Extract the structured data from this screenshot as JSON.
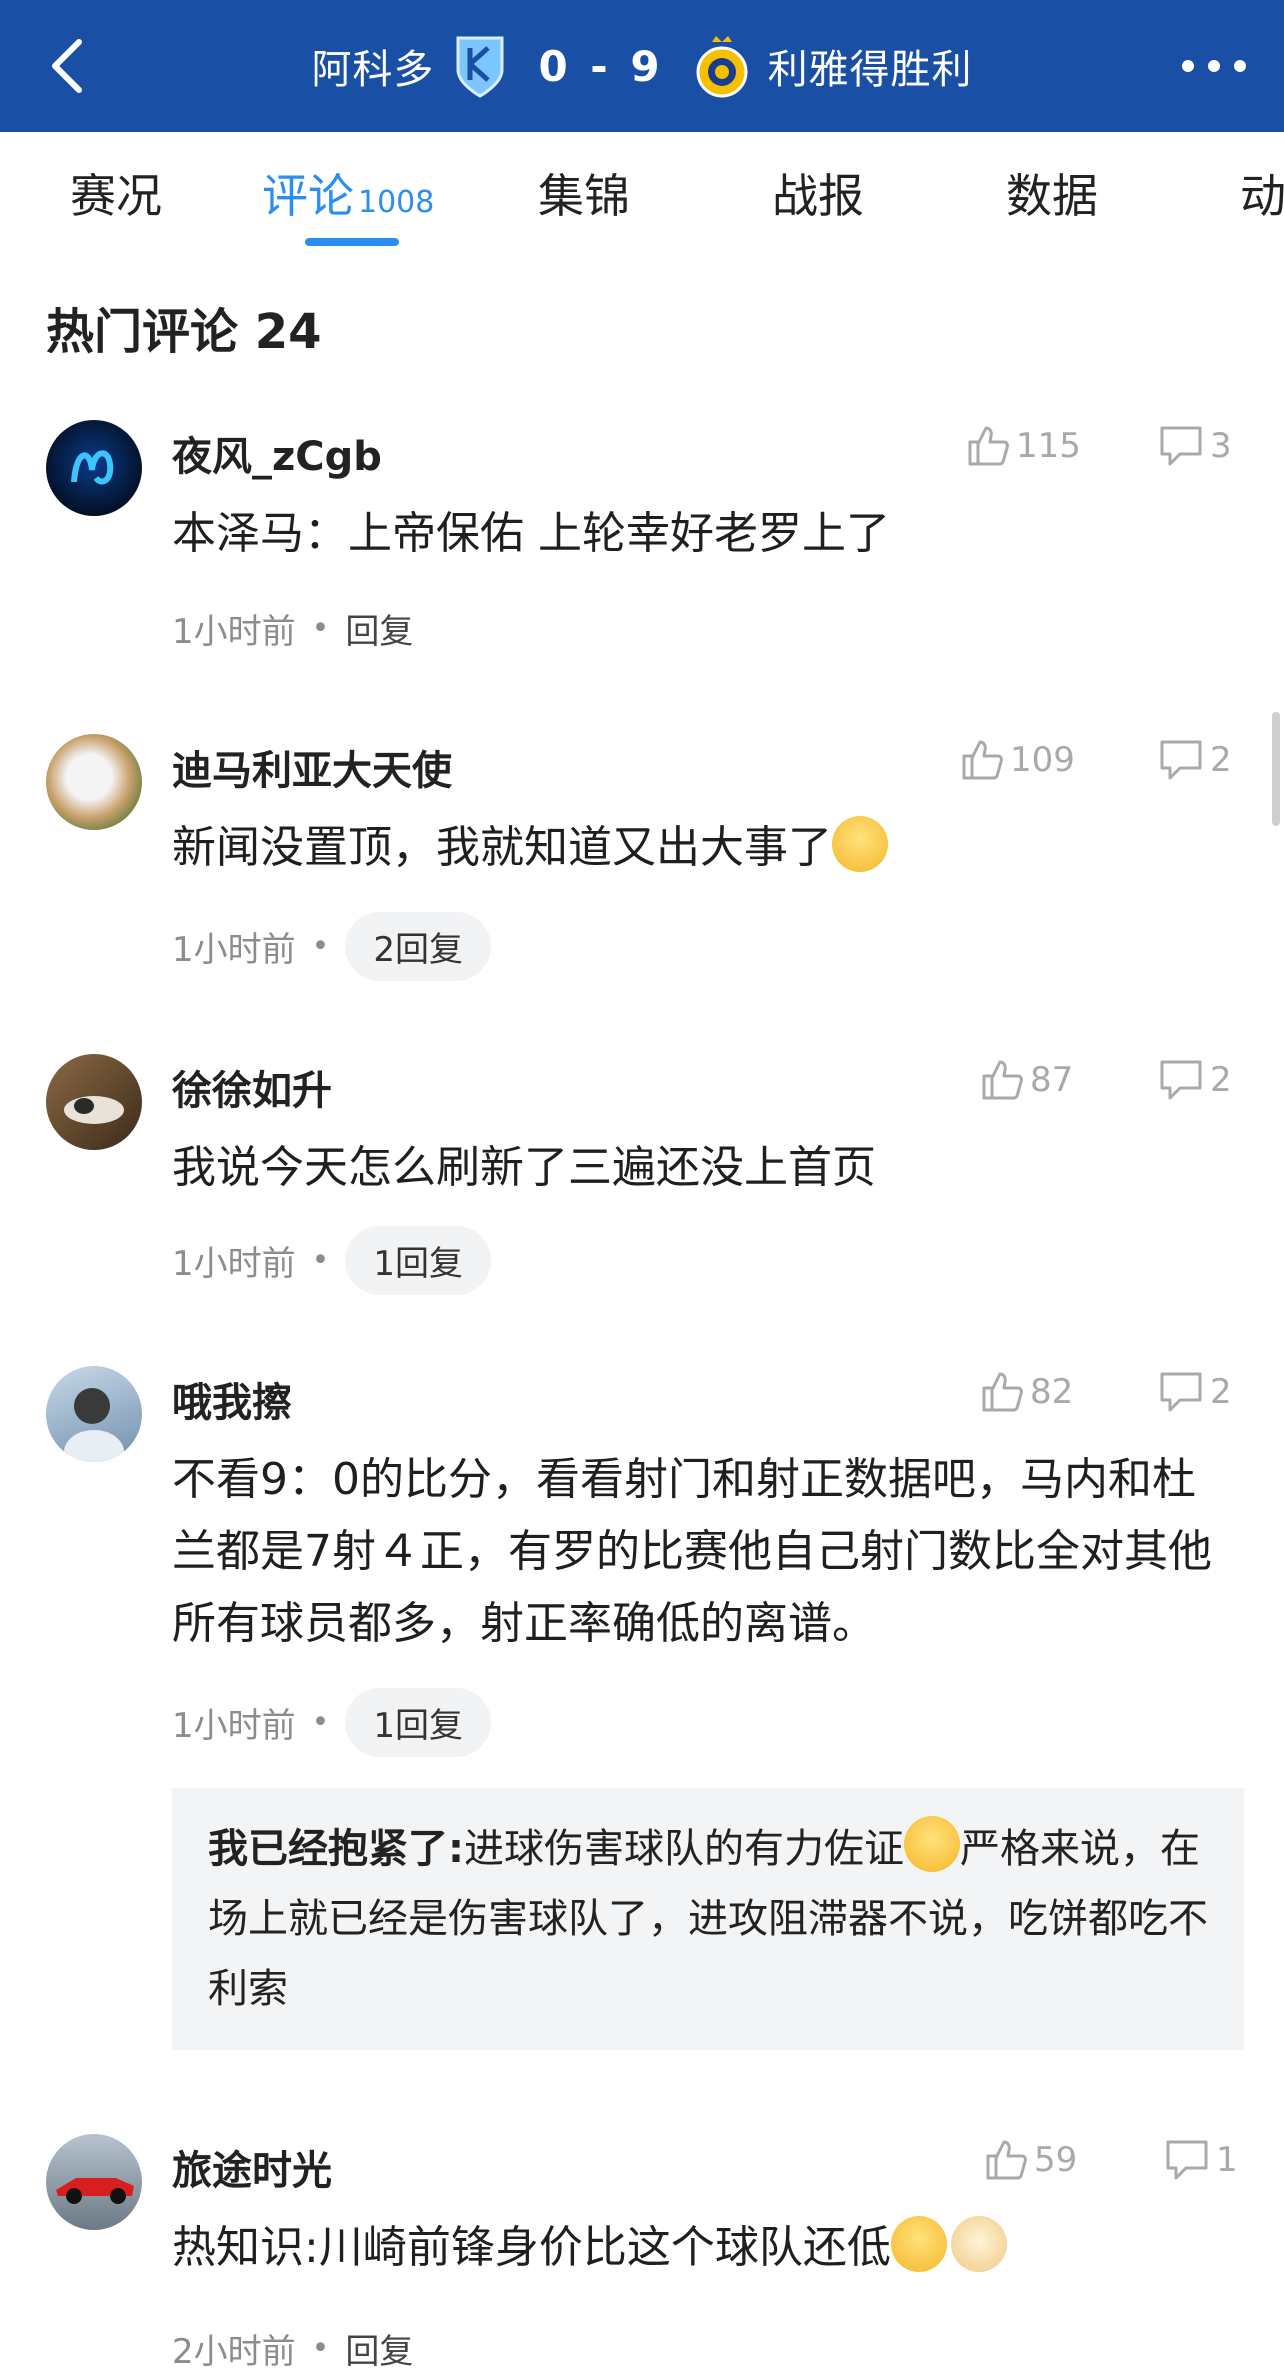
{
  "header": {
    "home_team": "阿科多",
    "score": "0 - 9",
    "away_result": "利雅得胜利",
    "colors": {
      "bar": "#1a4fa6",
      "accent": "#2b8ef0"
    }
  },
  "tabs": [
    {
      "label": "赛况"
    },
    {
      "label": "评论",
      "count": "1008",
      "active": true
    },
    {
      "label": "集锦"
    },
    {
      "label": "战报"
    },
    {
      "label": "数据"
    },
    {
      "label": "动"
    }
  ],
  "hot_comments_title": "热门评论 24",
  "comments": [
    {
      "user": "夜风_zCgb",
      "likes": "115",
      "replies_count": "3",
      "text": "本泽马：上帝保佑 上轮幸好老罗上了",
      "time": "1小时前",
      "reply_label": "回复"
    },
    {
      "user": "迪马利亚大天使",
      "likes": "109",
      "replies_count": "2",
      "text": "新闻没置顶，我就知道又出大事了",
      "time": "1小时前",
      "reply_label": "2回复"
    },
    {
      "user": "徐徐如升",
      "likes": "87",
      "replies_count": "2",
      "text": "我说今天怎么刷新了三遍还没上首页",
      "time": "1小时前",
      "reply_label": "1回复"
    },
    {
      "user": "哦我擦",
      "likes": "82",
      "replies_count": "2",
      "text": "不看9：0的比分，看看射门和射正数据吧，马内和杜兰都是7射４正，有罗的比赛他自己射门数比全对其他所有球员都多，射正率确低的离谱。",
      "time": "1小时前",
      "reply_label": "1回复",
      "sub_reply": {
        "user": "我已经抱紧了:",
        "text_a": "进球伤害球队的有力佐证",
        "text_b": "严格来说，在场上就已经是伤害球队了，进攻阻滞器不说，吃饼都吃不利索"
      }
    },
    {
      "user": "旅途时光",
      "likes": "59",
      "replies_count": "1",
      "text": "热知识:川崎前锋身价比这个球队还低",
      "time": "2小时前",
      "reply_label": "回复"
    }
  ]
}
